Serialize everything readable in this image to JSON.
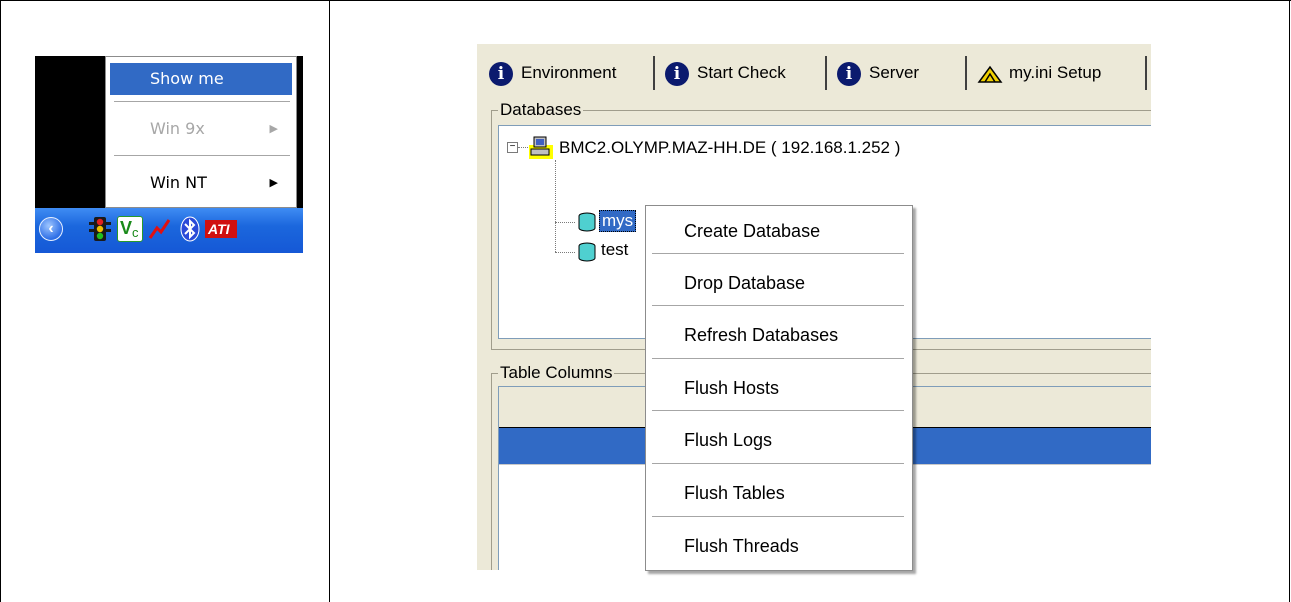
{
  "tray_menu": {
    "items": [
      {
        "label": "Show me",
        "state": "selected"
      },
      {
        "label": "Win 9x",
        "state": "disabled",
        "submenu": true
      },
      {
        "label": "Win NT",
        "state": "normal",
        "submenu": true
      }
    ],
    "submenu_arrow": "▶",
    "taskbar_icons": [
      "back-arrow-icon",
      "traffic-light-icon",
      "vc-icon",
      "network-icon",
      "bluetooth-icon",
      "ati-icon"
    ],
    "ati_label": "ATI",
    "vc_label": "V",
    "vc_sub": "c"
  },
  "mysql_admin": {
    "tabs": [
      {
        "label": "Environment",
        "icon": "info-icon"
      },
      {
        "label": "Start Check",
        "icon": "info-icon"
      },
      {
        "label": "Server",
        "icon": "info-icon"
      },
      {
        "label": "my.ini Setup",
        "icon": "setup-icon"
      }
    ],
    "info_glyph": "i",
    "databases_legend": "Databases",
    "tree": {
      "expander": "−",
      "server": "BMC2.OLYMP.MAZ-HH.DE ( 192.168.1.252 )",
      "databases": [
        "mys",
        "test"
      ]
    },
    "table_columns_legend": "Table Columns",
    "context_menu": [
      "Create Database",
      "Drop Database",
      "Refresh Databases",
      "Flush Hosts",
      "Flush Logs",
      "Flush Tables",
      "Flush Threads"
    ],
    "colors": {
      "selection": "#316ac5",
      "window_bg": "#ece9d8",
      "taskbar": "#1558d6"
    }
  }
}
